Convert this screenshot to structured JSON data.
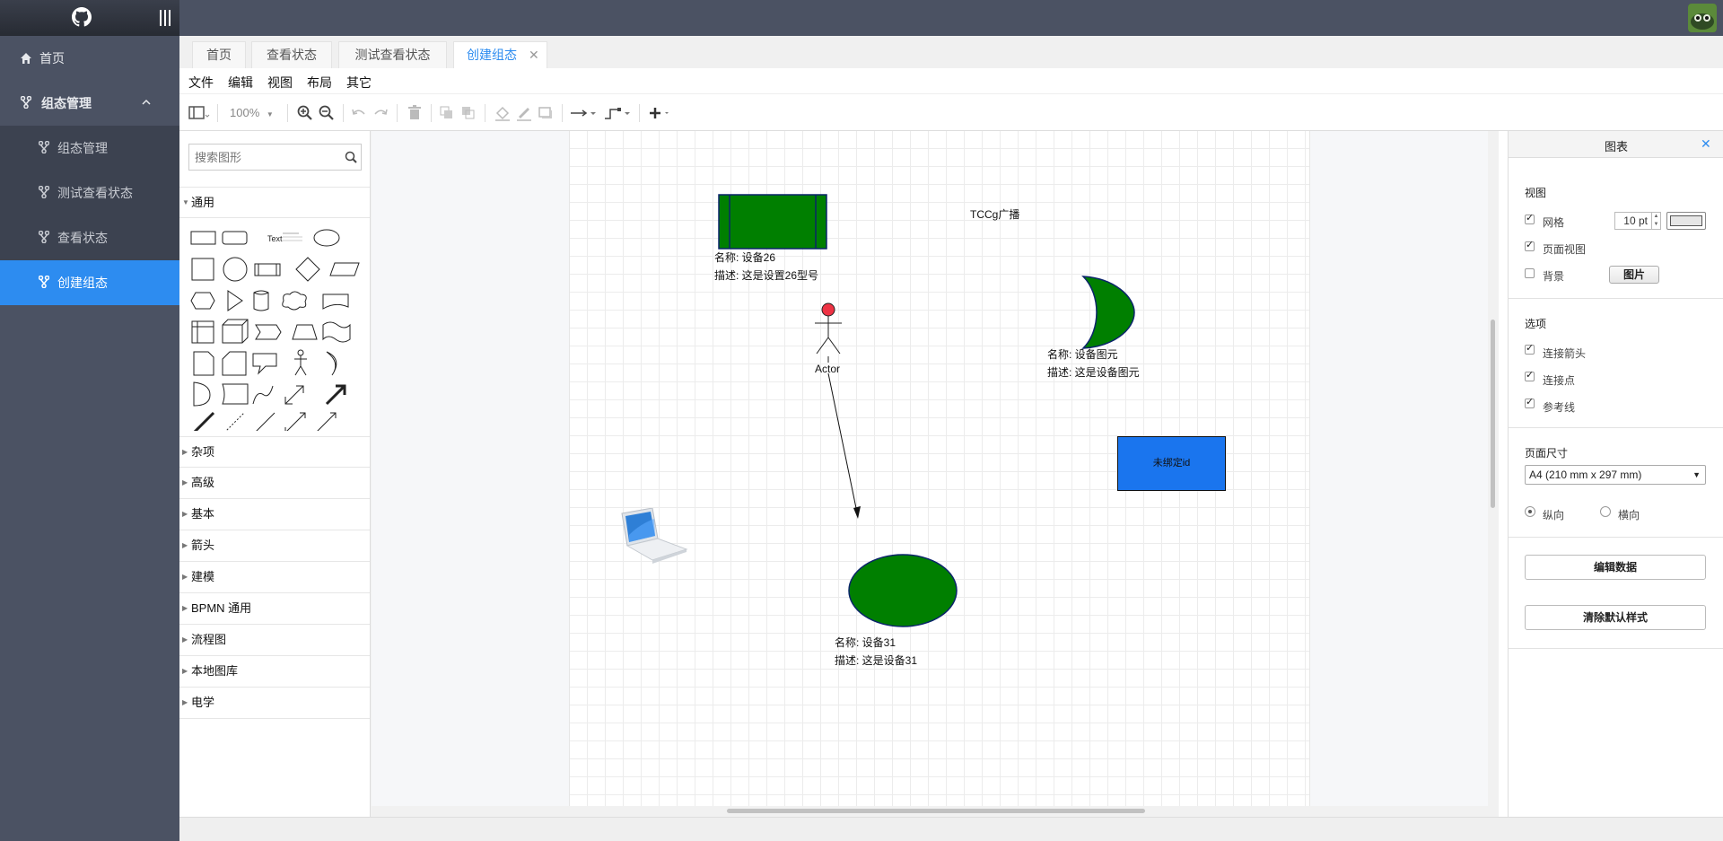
{
  "sidebar": {
    "items": [
      {
        "label": "首页"
      },
      {
        "label": "组态管理"
      },
      {
        "label": "组态管理"
      },
      {
        "label": "测试查看状态"
      },
      {
        "label": "查看状态"
      },
      {
        "label": "创建组态"
      }
    ]
  },
  "tabs": [
    {
      "label": "首页"
    },
    {
      "label": "查看状态"
    },
    {
      "label": "测试查看状态"
    },
    {
      "label": "创建组态"
    }
  ],
  "menus": [
    "文件",
    "编辑",
    "视图",
    "布局",
    "其它"
  ],
  "toolbar": {
    "zoom": "100%"
  },
  "shapes_panel": {
    "search_placeholder": "搜索图形",
    "general": "通用",
    "text_shape": "Text",
    "categories": [
      "杂项",
      "高级",
      "基本",
      "箭头",
      "建模",
      "BPMN 通用",
      "流程图",
      "本地图库",
      "电学"
    ]
  },
  "canvas": {
    "device26": {
      "name": "名称: 设备26",
      "desc": "描述: 这是设置26型号"
    },
    "broadcast_label": "TCCg广播",
    "actor_label": "Actor",
    "moon": {
      "name": "名称: 设备图元",
      "desc": "描述: 这是设备图元"
    },
    "unbound_box": "未绑定id",
    "device31": {
      "name": "名称: 设备31",
      "desc": "描述: 这是设备31"
    }
  },
  "right_panel": {
    "title": "图表",
    "view_section": "视图",
    "grid": "网格",
    "grid_size": "10 pt",
    "page_view": "页面视图",
    "background": "背景",
    "image_button": "图片",
    "options_section": "选项",
    "connect_arrows": "连接箭头",
    "connect_points": "连接点",
    "guides": "参考线",
    "page_size_section": "页面尺寸",
    "page_size": "A4 (210 mm x 297 mm)",
    "portrait": "纵向",
    "landscape": "横向",
    "edit_data": "编辑数据",
    "clear_style": "清除默认样式"
  },
  "colors": {
    "accent": "#2d8cf0",
    "sidebar": "#4b5263",
    "shape_green": "#007f00",
    "shape_blue": "#1a75ee"
  }
}
